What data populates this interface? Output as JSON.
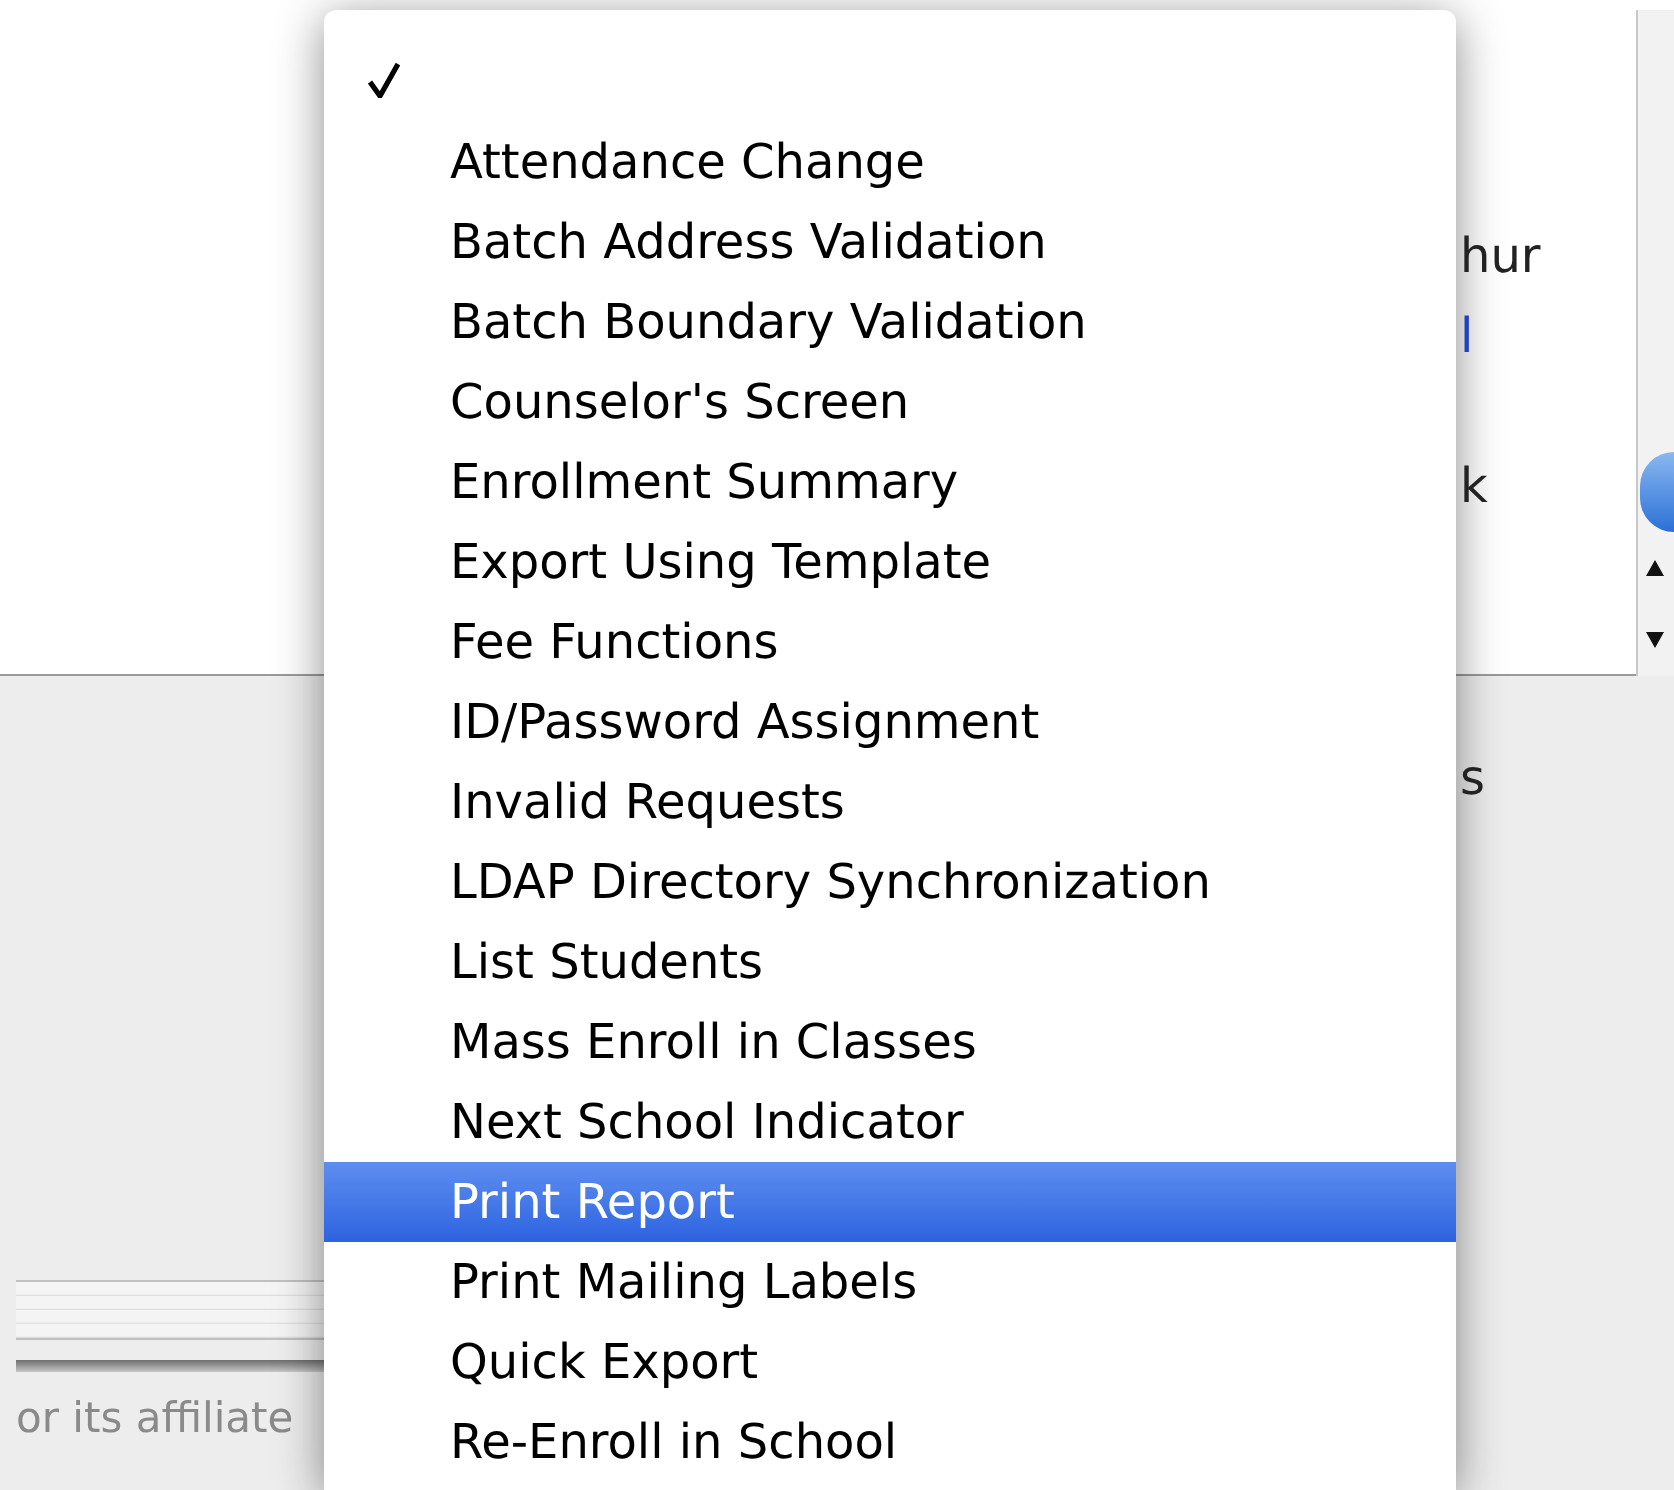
{
  "background": {
    "list_fragments": [
      "hur",
      "l",
      "k"
    ],
    "label_fragment": "s",
    "footer": "or its affiliate"
  },
  "menu": {
    "items": [
      {
        "checked": true,
        "selected": false
      },
      {
        "label": "Attendance Change",
        "checked": false,
        "selected": false
      },
      {
        "label": "Batch Address Validation",
        "checked": false,
        "selected": false
      },
      {
        "label": "Batch Boundary Validation",
        "checked": false,
        "selected": false
      },
      {
        "label": "Counselor's Screen",
        "checked": false,
        "selected": false
      },
      {
        "label": "Enrollment Summary",
        "checked": false,
        "selected": false
      },
      {
        "label": "Export Using Template",
        "checked": false,
        "selected": false
      },
      {
        "label": "Fee Functions",
        "checked": false,
        "selected": false
      },
      {
        "label": "ID/Password Assignment",
        "checked": false,
        "selected": false
      },
      {
        "label": "Invalid Requests",
        "checked": false,
        "selected": false
      },
      {
        "label": "LDAP Directory Synchronization",
        "checked": false,
        "selected": false
      },
      {
        "label": "List Students",
        "checked": false,
        "selected": false
      },
      {
        "label": "Mass Enroll in Classes",
        "checked": false,
        "selected": false
      },
      {
        "label": "Next School Indicator",
        "checked": false,
        "selected": false
      },
      {
        "label": "Print Report",
        "checked": false,
        "selected": true
      },
      {
        "label": "Print Mailing Labels",
        "checked": false,
        "selected": false
      },
      {
        "label": "Quick Export",
        "checked": false,
        "selected": false
      },
      {
        "label": "Re-Enroll in School",
        "checked": false,
        "selected": false
      }
    ]
  }
}
